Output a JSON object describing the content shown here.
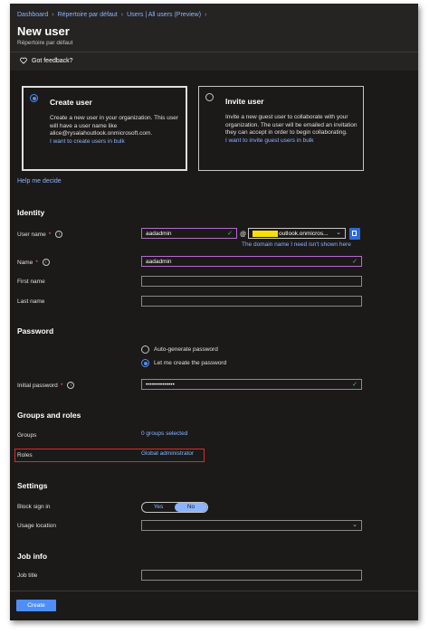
{
  "breadcrumb": [
    "Dashboard",
    "Répertoire par défaut",
    "Users | All users (Preview)"
  ],
  "page": {
    "title": "New user",
    "subtitle": "Répertoire par défaut"
  },
  "feedback": "Got feedback?",
  "options": {
    "create": {
      "title": "Create user",
      "desc": "Create a new user in your organization. This user will have a user name like alice@rysalahoutlook.onmicrosoft.com.",
      "link": "I want to create users in bulk",
      "selected": true
    },
    "invite": {
      "title": "Invite user",
      "desc": "Invite a new guest user to collaborate with your organization. The user will be emailed an invitation they can accept in order to begin collaborating.",
      "link": "I want to invite guest users in bulk",
      "selected": false
    }
  },
  "help_link": "Help me decide",
  "identity": {
    "heading": "Identity",
    "username_label": "User name",
    "username_value": "aadadmin",
    "at": "@",
    "domain_value": "outlook.onmicros...",
    "domain_link": "The domain name I need isn't shown here",
    "name_label": "Name",
    "name_value": "aadadmin",
    "firstname_label": "First name",
    "lastname_label": "Last name"
  },
  "password": {
    "heading": "Password",
    "auto_label": "Auto-generate password",
    "manual_label": "Let me create the password",
    "initial_label": "Initial password",
    "initial_value": "••••••••••••••"
  },
  "groups": {
    "heading": "Groups and roles",
    "groups_label": "Groups",
    "groups_value": "0 groups selected",
    "roles_label": "Roles",
    "roles_value": "Global administrator"
  },
  "settings": {
    "heading": "Settings",
    "block_label": "Block sign in",
    "toggle_yes": "Yes",
    "toggle_no": "No",
    "usage_label": "Usage location"
  },
  "job": {
    "heading": "Job info",
    "title_label": "Job title"
  },
  "actions": {
    "create": "Create"
  },
  "colors": {
    "accent": "#4f8ef7",
    "link": "#8ab4ff",
    "background": "#1b1a19",
    "required": "#ff6b6b",
    "highlight": "#d32f2f"
  }
}
